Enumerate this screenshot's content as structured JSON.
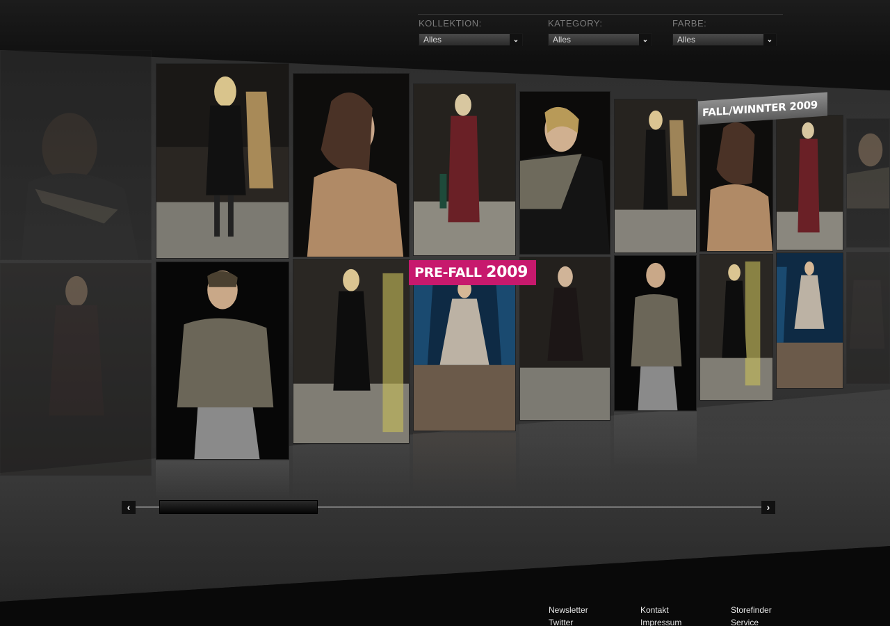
{
  "filters": [
    {
      "label": "KOLLEKTION:",
      "value": "Alles"
    },
    {
      "label": "KATEGORY:",
      "value": "Alles"
    },
    {
      "label": "FARBE:",
      "value": "Alles"
    }
  ],
  "tags": {
    "fall_winter": "FALL/WINNTER 2009",
    "pre_fall_prefix": "PRE-FALL",
    "pre_fall_year": "2009"
  },
  "scrollbar": {
    "left_icon": "‹",
    "right_icon": "›",
    "position": 0.06
  },
  "footer": {
    "col1": [
      "Newsletter",
      "Twitter"
    ],
    "col2": [
      "Kontakt",
      "Impressum"
    ],
    "col3": [
      "Storefinder",
      "Service"
    ]
  },
  "colors": {
    "pre_fall_tag": "#c7196d",
    "fall_winter_tag": "#7a7a7a",
    "background": "#0c0c0c"
  }
}
